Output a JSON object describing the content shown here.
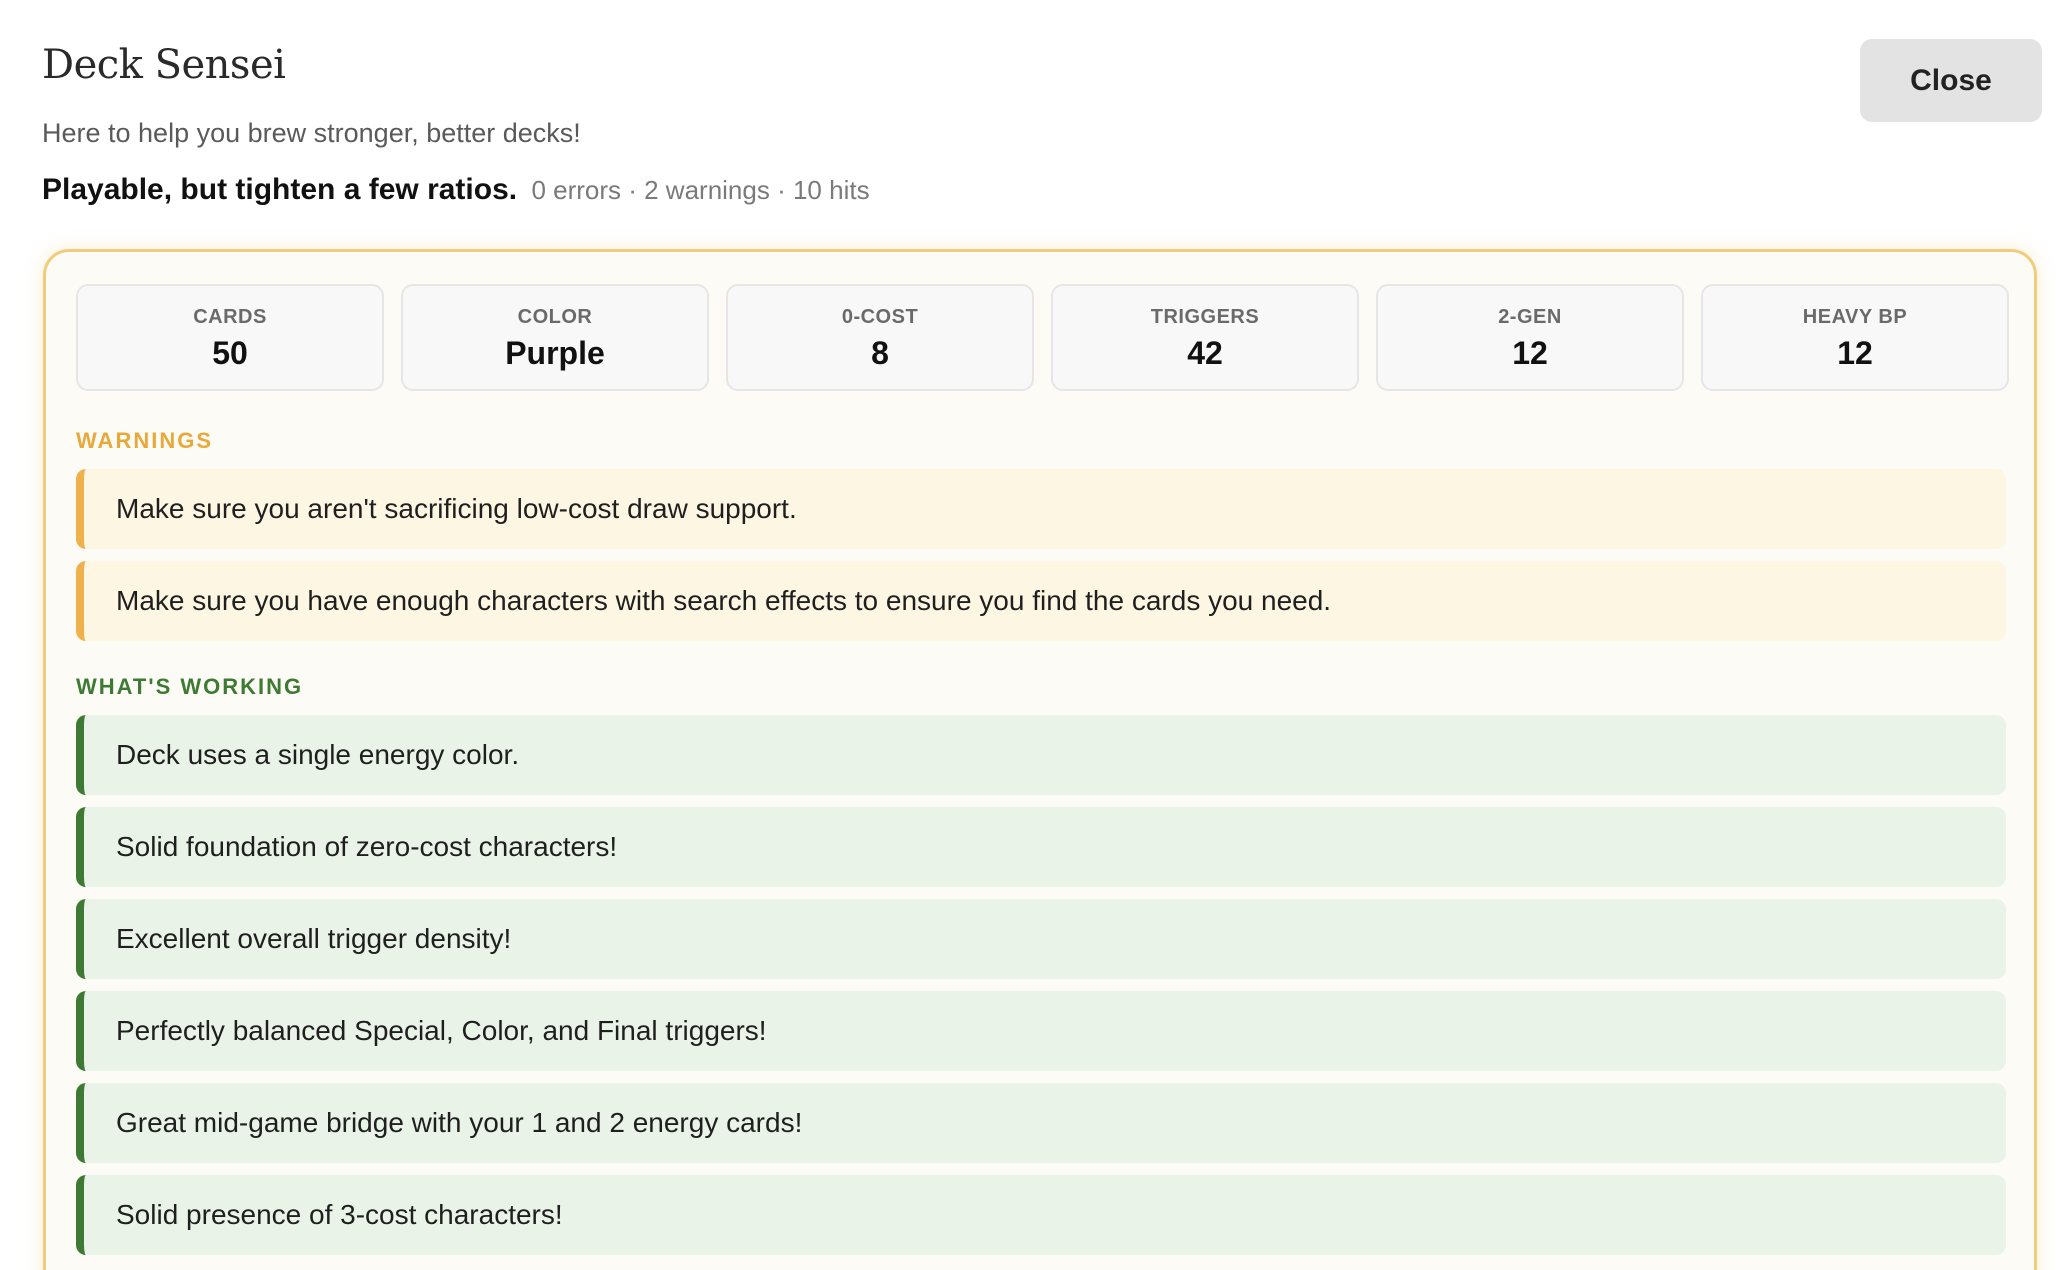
{
  "header": {
    "title": "Deck Sensei",
    "subtitle": "Here to help you brew stronger, better decks!",
    "verdict": "Playable, but tighten a few ratios.",
    "counts": "0 errors · 2 warnings · 10 hits",
    "close_label": "Close"
  },
  "stats": [
    {
      "label": "CARDS",
      "value": "50"
    },
    {
      "label": "COLOR",
      "value": "Purple"
    },
    {
      "label": "0-COST",
      "value": "8"
    },
    {
      "label": "TRIGGERS",
      "value": "42"
    },
    {
      "label": "2-GEN",
      "value": "12"
    },
    {
      "label": "HEAVY BP",
      "value": "12"
    }
  ],
  "warnings": {
    "heading": "WARNINGS",
    "items": [
      "Make sure you aren't sacrificing low-cost draw support.",
      "Make sure you have enough characters with search effects to ensure you find the cards you need."
    ]
  },
  "working": {
    "heading": "WHAT'S WORKING",
    "items": [
      "Deck uses a single energy color.",
      "Solid foundation of zero-cost characters!",
      "Excellent overall trigger density!",
      "Perfectly balanced Special, Color, and Final triggers!",
      "Great mid-game bridge with your 1 and 2 energy cards!",
      "Solid presence of 3-cost characters!"
    ]
  },
  "colors": {
    "warning_accent": "#efb14b",
    "success_accent": "#3f7a35",
    "panel_border": "#f0cd7e"
  }
}
